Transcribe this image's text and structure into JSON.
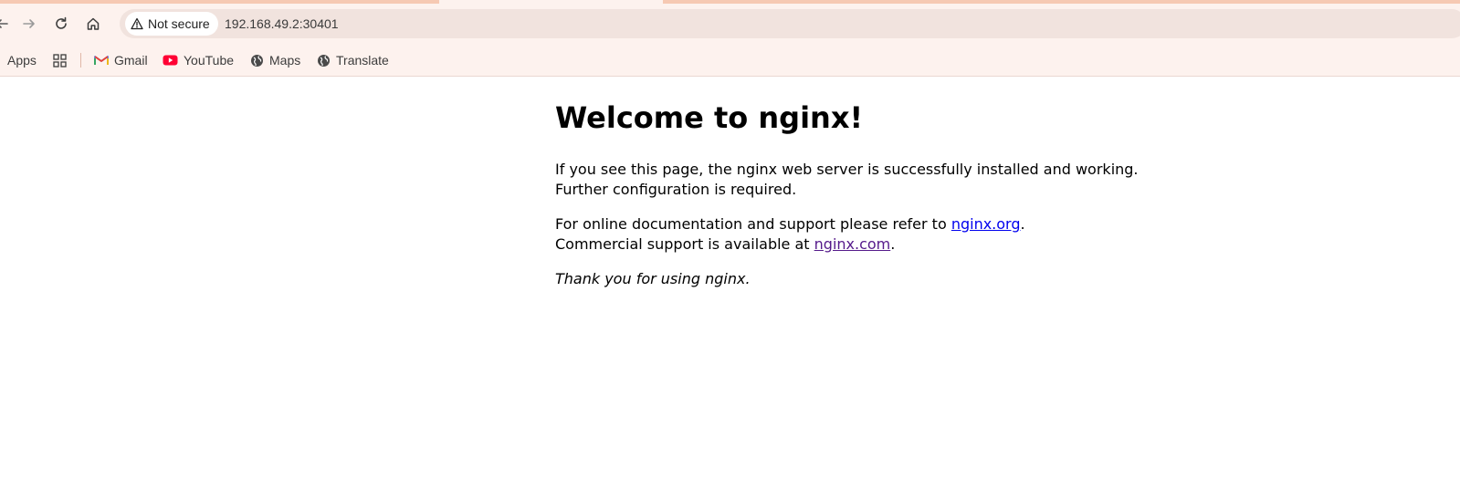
{
  "browser": {
    "security_label": "Not secure",
    "url": "192.168.49.2:30401"
  },
  "bookmarks": [
    {
      "label": "Apps",
      "icon": "apps-icon"
    },
    {
      "label": "",
      "icon": "grid-icon"
    },
    {
      "label": "Gmail",
      "icon": "gmail-icon"
    },
    {
      "label": "YouTube",
      "icon": "youtube-icon"
    },
    {
      "label": "Maps",
      "icon": "globe-icon"
    },
    {
      "label": "Translate",
      "icon": "globe-icon"
    }
  ],
  "page": {
    "heading": "Welcome to nginx!",
    "para1": "If you see this page, the nginx web server is successfully installed and working. Further configuration is required.",
    "para2_line1_prefix": "For online documentation and support please refer to ",
    "para2_link1": "nginx.org",
    "para2_line1_suffix": ".",
    "para2_line2_prefix": "Commercial support is available at ",
    "para2_link2": "nginx.com",
    "para2_line2_suffix": ".",
    "para3": "Thank you for using nginx."
  },
  "colors": {
    "toolbar_bg": "#fdf2ee",
    "omnibox_bg": "#f1e3de",
    "link_unvisited": "#0000ee",
    "link_visited": "#551a8b",
    "youtube_red": "#ff0033"
  }
}
